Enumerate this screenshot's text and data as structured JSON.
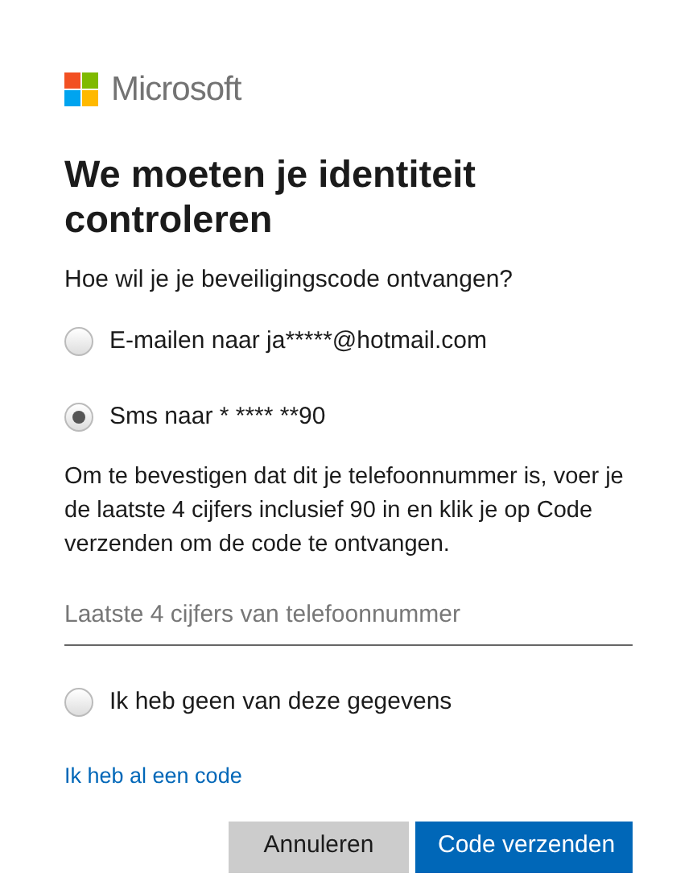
{
  "brand": {
    "name": "Microsoft"
  },
  "title": "We moeten je identiteit controleren",
  "question": "Hoe wil je je beveiligingscode ontvangen?",
  "options": [
    {
      "label": "E-mailen naar ja*****@hotmail.com",
      "selected": false
    },
    {
      "label": "Sms naar * **** **90",
      "selected": true
    }
  ],
  "instructions": "Om te bevestigen dat dit je telefoonnummer is, voer je de laatste 4 cijfers inclusief 90 in en klik je op Code verzenden om de code te ontvangen.",
  "phone_field": {
    "placeholder": "Laatste 4 cijfers van telefoonnummer"
  },
  "none_option": {
    "label": "Ik heb geen van deze gegevens",
    "selected": false
  },
  "have_code_link": "Ik heb al een code",
  "buttons": [
    {
      "label": "Annuleren",
      "kind": "secondary"
    },
    {
      "label": "Code verzenden",
      "kind": "primary"
    }
  ]
}
